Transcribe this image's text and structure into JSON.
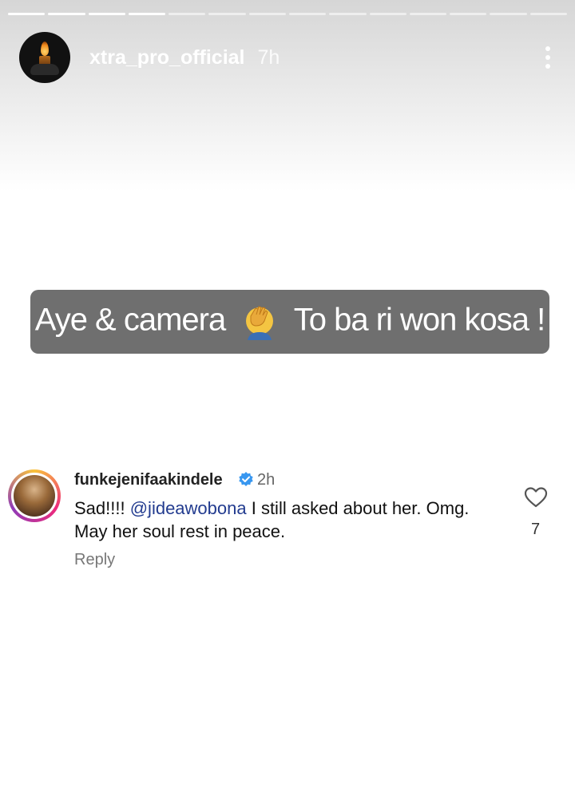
{
  "story": {
    "segments_total": 14,
    "segments_viewed": 4,
    "username": "xtra_pro_official",
    "time": "7h"
  },
  "caption": {
    "before_emoji": "Aye & camera",
    "emoji": "face-palm-emoji",
    "after_emoji": "To ba ri won kosa !"
  },
  "comment": {
    "username": "funkejenifaakindele",
    "verified": true,
    "time": "2h",
    "text_prefix": "Sad!!!! ",
    "mention": "@jideawobona",
    "text_suffix": " I still asked about her. Omg. May her soul rest in peace.",
    "reply_label": "Reply",
    "likes": "7"
  },
  "colors": {
    "caption_bg": "#6f6f6f",
    "mention": "#223b8f",
    "verified": "#3897f0"
  }
}
